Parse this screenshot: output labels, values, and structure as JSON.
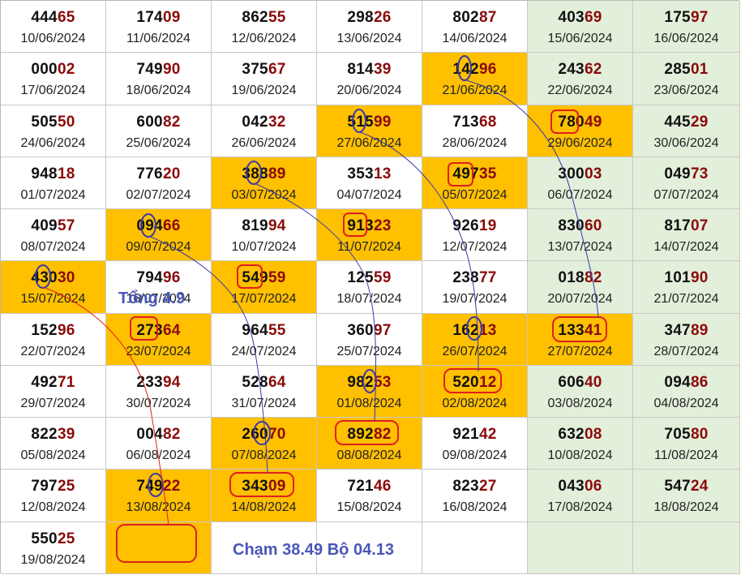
{
  "rows": [
    [
      {
        "head": "444",
        "tail": "65",
        "date": "10/06/2024",
        "bg": "white"
      },
      {
        "head": "174",
        "tail": "09",
        "date": "11/06/2024",
        "bg": "white"
      },
      {
        "head": "862",
        "tail": "55",
        "date": "12/06/2024",
        "bg": "white"
      },
      {
        "head": "298",
        "tail": "26",
        "date": "13/06/2024",
        "bg": "white"
      },
      {
        "head": "802",
        "tail": "87",
        "date": "14/06/2024",
        "bg": "white"
      },
      {
        "head": "403",
        "tail": "69",
        "date": "15/06/2024",
        "bg": "green"
      },
      {
        "head": "175",
        "tail": "97",
        "date": "16/06/2024",
        "bg": "green"
      }
    ],
    [
      {
        "head": "000",
        "tail": "02",
        "date": "17/06/2024",
        "bg": "white"
      },
      {
        "head": "749",
        "tail": "90",
        "date": "18/06/2024",
        "bg": "white"
      },
      {
        "head": "375",
        "tail": "67",
        "date": "19/06/2024",
        "bg": "white"
      },
      {
        "head": "814",
        "tail": "39",
        "date": "20/06/2024",
        "bg": "white"
      },
      {
        "head": "142",
        "tail": "96",
        "date": "21/06/2024",
        "bg": "orange"
      },
      {
        "head": "243",
        "tail": "62",
        "date": "22/06/2024",
        "bg": "green"
      },
      {
        "head": "285",
        "tail": "01",
        "date": "23/06/2024",
        "bg": "green"
      }
    ],
    [
      {
        "head": "505",
        "tail": "50",
        "date": "24/06/2024",
        "bg": "white"
      },
      {
        "head": "600",
        "tail": "82",
        "date": "25/06/2024",
        "bg": "white"
      },
      {
        "head": "042",
        "tail": "32",
        "date": "26/06/2024",
        "bg": "white"
      },
      {
        "head": "515",
        "tail": "99",
        "date": "27/06/2024",
        "bg": "orange"
      },
      {
        "head": "713",
        "tail": "68",
        "date": "28/06/2024",
        "bg": "white"
      },
      {
        "head": "780",
        "tail": "49",
        "date": "29/06/2024",
        "bg": "orange"
      },
      {
        "head": "445",
        "tail": "29",
        "date": "30/06/2024",
        "bg": "green"
      }
    ],
    [
      {
        "head": "948",
        "tail": "18",
        "date": "01/07/2024",
        "bg": "white"
      },
      {
        "head": "776",
        "tail": "20",
        "date": "02/07/2024",
        "bg": "white"
      },
      {
        "head": "388",
        "tail": "89",
        "date": "03/07/2024",
        "bg": "orange"
      },
      {
        "head": "353",
        "tail": "13",
        "date": "04/07/2024",
        "bg": "white"
      },
      {
        "head": "497",
        "tail": "35",
        "date": "05/07/2024",
        "bg": "orange"
      },
      {
        "head": "300",
        "tail": "03",
        "date": "06/07/2024",
        "bg": "green"
      },
      {
        "head": "049",
        "tail": "73",
        "date": "07/07/2024",
        "bg": "green"
      }
    ],
    [
      {
        "head": "409",
        "tail": "57",
        "date": "08/07/2024",
        "bg": "white"
      },
      {
        "head": "094",
        "tail": "66",
        "date": "09/07/2024",
        "bg": "orange"
      },
      {
        "head": "819",
        "tail": "94",
        "date": "10/07/2024",
        "bg": "white"
      },
      {
        "head": "913",
        "tail": "23",
        "date": "11/07/2024",
        "bg": "orange"
      },
      {
        "head": "926",
        "tail": "19",
        "date": "12/07/2024",
        "bg": "white"
      },
      {
        "head": "830",
        "tail": "60",
        "date": "13/07/2024",
        "bg": "green"
      },
      {
        "head": "817",
        "tail": "07",
        "date": "14/07/2024",
        "bg": "green"
      }
    ],
    [
      {
        "head": "430",
        "tail": "30",
        "date": "15/07/2024",
        "bg": "orange"
      },
      {
        "head": "794",
        "tail": "96",
        "date": "16/07/2024",
        "bg": "white"
      },
      {
        "head": "549",
        "tail": "59",
        "date": "17/07/2024",
        "bg": "orange"
      },
      {
        "head": "125",
        "tail": "59",
        "date": "18/07/2024",
        "bg": "white"
      },
      {
        "head": "238",
        "tail": "77",
        "date": "19/07/2024",
        "bg": "white"
      },
      {
        "head": "018",
        "tail": "82",
        "date": "20/07/2024",
        "bg": "green"
      },
      {
        "head": "101",
        "tail": "90",
        "date": "21/07/2024",
        "bg": "green"
      }
    ],
    [
      {
        "head": "152",
        "tail": "96",
        "date": "22/07/2024",
        "bg": "white"
      },
      {
        "head": "273",
        "tail": "64",
        "date": "23/07/2024",
        "bg": "orange"
      },
      {
        "head": "964",
        "tail": "55",
        "date": "24/07/2024",
        "bg": "white"
      },
      {
        "head": "360",
        "tail": "97",
        "date": "25/07/2024",
        "bg": "white"
      },
      {
        "head": "162",
        "tail": "13",
        "date": "26/07/2024",
        "bg": "orange"
      },
      {
        "head": "133",
        "tail": "41",
        "date": "27/07/2024",
        "bg": "orange"
      },
      {
        "head": "347",
        "tail": "89",
        "date": "28/07/2024",
        "bg": "green"
      }
    ],
    [
      {
        "head": "492",
        "tail": "71",
        "date": "29/07/2024",
        "bg": "white"
      },
      {
        "head": "233",
        "tail": "94",
        "date": "30/07/2024",
        "bg": "white"
      },
      {
        "head": "528",
        "tail": "64",
        "date": "31/07/2024",
        "bg": "white"
      },
      {
        "head": "982",
        "tail": "53",
        "date": "01/08/2024",
        "bg": "orange"
      },
      {
        "head": "520",
        "tail": "12",
        "date": "02/08/2024",
        "bg": "orange"
      },
      {
        "head": "606",
        "tail": "40",
        "date": "03/08/2024",
        "bg": "green"
      },
      {
        "head": "094",
        "tail": "86",
        "date": "04/08/2024",
        "bg": "green"
      }
    ],
    [
      {
        "head": "822",
        "tail": "39",
        "date": "05/08/2024",
        "bg": "white"
      },
      {
        "head": "004",
        "tail": "82",
        "date": "06/08/2024",
        "bg": "white"
      },
      {
        "head": "260",
        "tail": "70",
        "date": "07/08/2024",
        "bg": "orange"
      },
      {
        "head": "892",
        "tail": "82",
        "date": "08/08/2024",
        "bg": "orange"
      },
      {
        "head": "921",
        "tail": "42",
        "date": "09/08/2024",
        "bg": "white"
      },
      {
        "head": "632",
        "tail": "08",
        "date": "10/08/2024",
        "bg": "green"
      },
      {
        "head": "705",
        "tail": "80",
        "date": "11/08/2024",
        "bg": "green"
      }
    ],
    [
      {
        "head": "797",
        "tail": "25",
        "date": "12/08/2024",
        "bg": "white"
      },
      {
        "head": "749",
        "tail": "22",
        "date": "13/08/2024",
        "bg": "orange"
      },
      {
        "head": "343",
        "tail": "09",
        "date": "14/08/2024",
        "bg": "orange"
      },
      {
        "head": "721",
        "tail": "46",
        "date": "15/08/2024",
        "bg": "white"
      },
      {
        "head": "823",
        "tail": "27",
        "date": "16/08/2024",
        "bg": "white"
      },
      {
        "head": "043",
        "tail": "06",
        "date": "17/08/2024",
        "bg": "green"
      },
      {
        "head": "547",
        "tail": "24",
        "date": "18/08/2024",
        "bg": "green"
      }
    ],
    [
      {
        "head": "550",
        "tail": "25",
        "date": "19/08/2024",
        "bg": "white"
      },
      {
        "head": "",
        "tail": "",
        "date": "",
        "bg": "orange"
      },
      {
        "head": "",
        "tail": "",
        "date": "",
        "bg": "white"
      },
      {
        "head": "",
        "tail": "",
        "date": "",
        "bg": "white"
      },
      {
        "head": "",
        "tail": "",
        "date": "",
        "bg": "white"
      },
      {
        "head": "",
        "tail": "",
        "date": "",
        "bg": "green"
      },
      {
        "head": "",
        "tail": "",
        "date": "",
        "bg": "green"
      }
    ]
  ],
  "notes": {
    "tong": "Tổng 4.9",
    "cham": "Chạm 38.49 Bộ 04.13"
  },
  "colors": {
    "orange": "#ffc000",
    "green": "#e2efda",
    "tail_red": "#8b0a0a",
    "marker_red": "#e0201e",
    "marker_blue": "#3a3aa8"
  },
  "annotations": {
    "red_box_icons": "rounded-rectangle marks around highlighted numbers",
    "blue_oval_icons": "oval marks around single digits",
    "trend_lines": "hand-drawn connector lines"
  }
}
